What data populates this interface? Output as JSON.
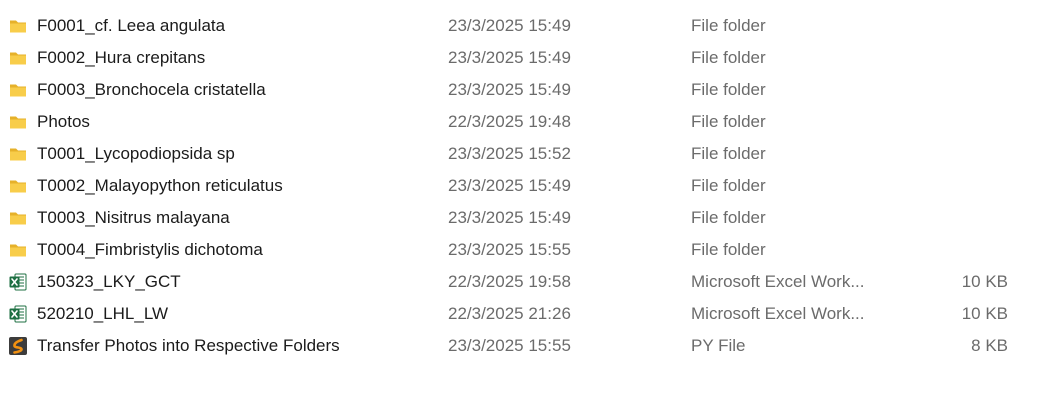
{
  "colors": {
    "folder": "#F8CD4A",
    "folder_back": "#E6B12A",
    "excel": "#1D6F42",
    "python_bg": "#3C3C3C",
    "python_fg": "#F29111",
    "meta_text": "#6b6b6b"
  },
  "files": [
    {
      "name": "F0001_cf. Leea angulata",
      "date": "23/3/2025 15:49",
      "type": "File folder",
      "size": "",
      "icon": "folder-icon"
    },
    {
      "name": "F0002_Hura crepitans",
      "date": "23/3/2025 15:49",
      "type": "File folder",
      "size": "",
      "icon": "folder-icon"
    },
    {
      "name": "F0003_Bronchocela cristatella",
      "date": "23/3/2025 15:49",
      "type": "File folder",
      "size": "",
      "icon": "folder-icon"
    },
    {
      "name": "Photos",
      "date": "22/3/2025 19:48",
      "type": "File folder",
      "size": "",
      "icon": "folder-icon"
    },
    {
      "name": "T0001_Lycopodiopsida sp",
      "date": "23/3/2025 15:52",
      "type": "File folder",
      "size": "",
      "icon": "folder-icon"
    },
    {
      "name": "T0002_Malayopython reticulatus",
      "date": "23/3/2025 15:49",
      "type": "File folder",
      "size": "",
      "icon": "folder-icon"
    },
    {
      "name": "T0003_Nisitrus malayana",
      "date": "23/3/2025 15:49",
      "type": "File folder",
      "size": "",
      "icon": "folder-icon"
    },
    {
      "name": "T0004_Fimbristylis dichotoma",
      "date": "23/3/2025 15:55",
      "type": "File folder",
      "size": "",
      "icon": "folder-icon"
    },
    {
      "name": "150323_LKY_GCT",
      "date": "22/3/2025 19:58",
      "type": "Microsoft Excel Work...",
      "size": "10 KB",
      "icon": "excel-file-icon"
    },
    {
      "name": "520210_LHL_LW",
      "date": "22/3/2025 21:26",
      "type": "Microsoft Excel Work...",
      "size": "10 KB",
      "icon": "excel-file-icon"
    },
    {
      "name": "Transfer Photos into Respective Folders",
      "date": "23/3/2025 15:55",
      "type": "PY File",
      "size": "8 KB",
      "icon": "python-file-icon"
    }
  ]
}
